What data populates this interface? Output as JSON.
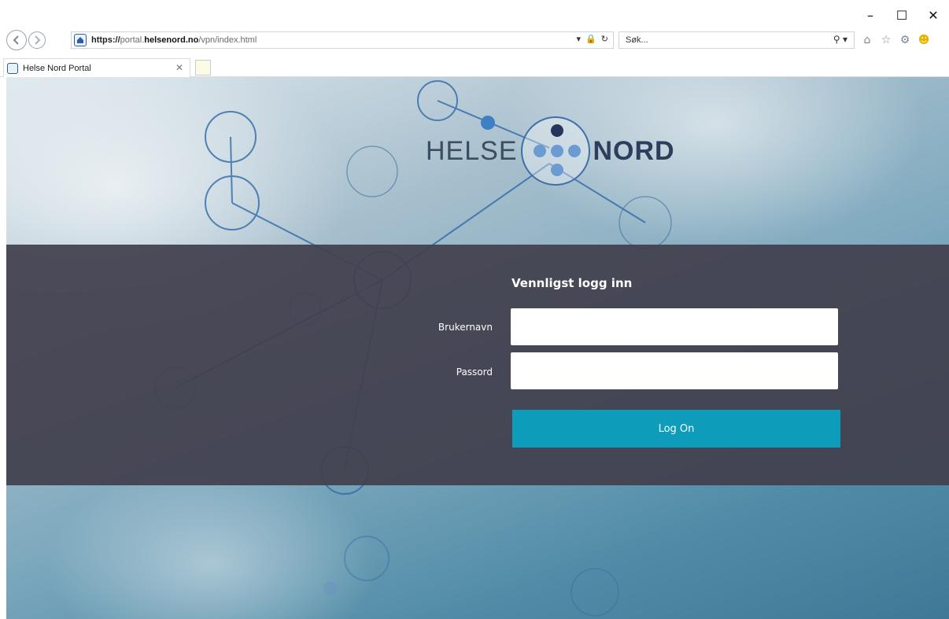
{
  "browser": {
    "url": {
      "protocol": "https://",
      "host_prefix": "portal.",
      "host": "helsenord.no",
      "path": "/vpn/index.html"
    },
    "search_placeholder": "Søk...",
    "tab_title": "Helse Nord Portal"
  },
  "logo": {
    "left_text": "HELSE",
    "right_text": "NORD"
  },
  "login": {
    "title": "Vennligst logg inn",
    "username_label": "Brukernavn",
    "password_label": "Passord",
    "submit_label": "Log On"
  },
  "colors": {
    "band": "#42404e",
    "button": "#0d9dbb",
    "logo_text": "#3b4c63"
  }
}
